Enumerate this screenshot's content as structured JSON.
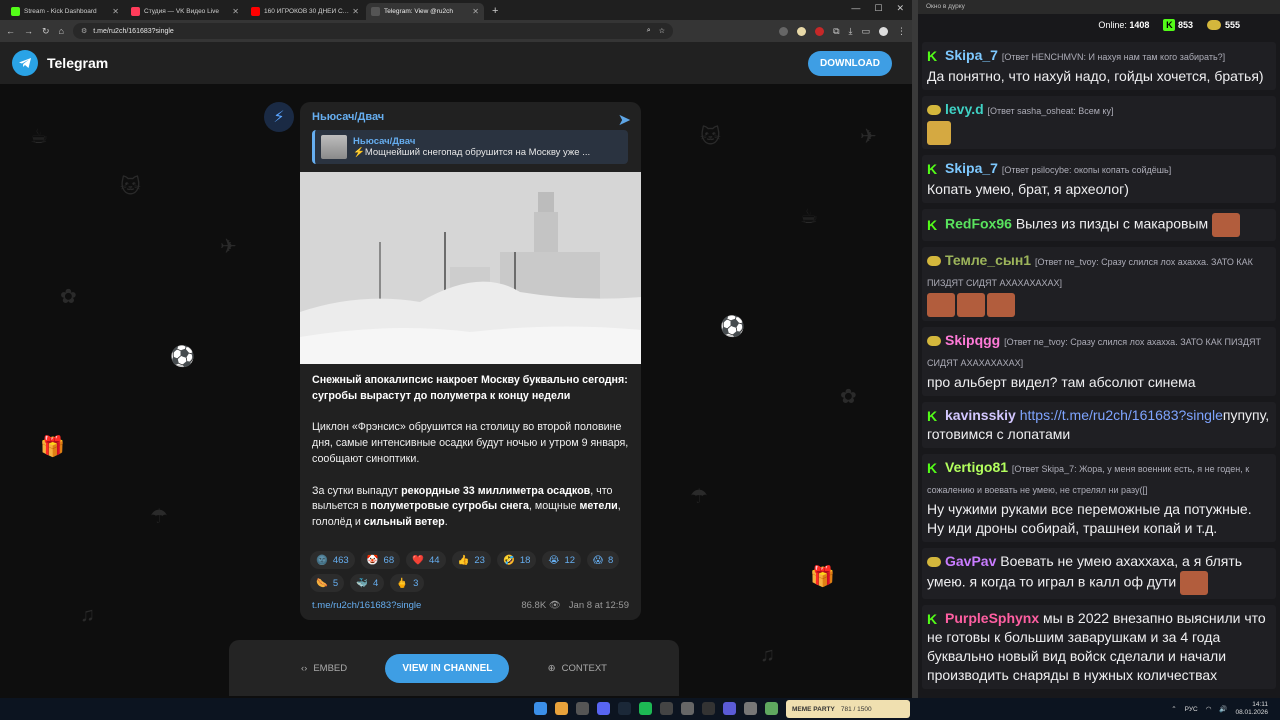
{
  "tabs": [
    {
      "title": "Stream - Kick Dashboard",
      "color": "#53fc18"
    },
    {
      "title": "Студия — VK Видео Live",
      "color": "#ff3c5a"
    },
    {
      "title": "160 ИГРОКОВ 30 ДНЕЙ СТРОЯ",
      "color": "#ff0000"
    },
    {
      "title": "Telegram: View @ru2ch",
      "color": "#555555"
    }
  ],
  "address": {
    "url": "t.me/ru2ch/161683?single"
  },
  "telegram": {
    "brand": "Telegram",
    "download": "DOWNLOAD"
  },
  "post": {
    "channel": "Ньюсач/Двач",
    "reply_name": "Ньюсач/Двач",
    "reply_text": "⚡️Мощнейший снегопад обрушится на Москву уже ...",
    "p1": "Снежный апокалипсис накроет Москву буквально сегодня: сугробы вырастут до полуметра к концу недели",
    "p2": "Циклон «Фрэнсис» обрушится на столицу во второй половине дня, самые интенсивные осадки будут ночью и утром 9 января, сообщают синоптики.",
    "p3a": "За сутки выпадут ",
    "p3b": "рекордные 33 миллиметра осадков",
    "p3c": ", что выльется в ",
    "p3d": "полуметровые сугробы снега",
    "p3e": ", мощные ",
    "p3f": "метели",
    "p3g": ", гололёд и ",
    "p3h": "сильный ветер",
    "p3i": ".",
    "link": "t.me/ru2ch/161683?single",
    "views": "86.8K",
    "date": "Jan 8 at 12:59",
    "reactions": [
      {
        "emoji": "🌚",
        "count": "463"
      },
      {
        "emoji": "🤡",
        "count": "68"
      },
      {
        "emoji": "❤️",
        "count": "44"
      },
      {
        "emoji": "👍",
        "count": "23"
      },
      {
        "emoji": "🤣",
        "count": "18"
      },
      {
        "emoji": "😭",
        "count": "12"
      },
      {
        "emoji": "😱",
        "count": "8"
      },
      {
        "emoji": "🌭",
        "count": "5"
      },
      {
        "emoji": "🐳",
        "count": "4"
      },
      {
        "emoji": "🖕",
        "count": "3"
      }
    ]
  },
  "actions": {
    "embed": "EMBED",
    "view": "VIEW IN CHANNEL",
    "context": "CONTEXT"
  },
  "chat": {
    "window_title": "Окно в дурку",
    "online_label": "Online:",
    "online": "1408",
    "count1": "853",
    "count2": "555",
    "messages": [
      {
        "user": "Skipa_7",
        "color": "#7ec9ff",
        "badge": "kick",
        "reply": "[Ответ HENCHMVN: И нахуя нам там кого забирать?]",
        "text": "Да понятно, что нахуй надо, гойды хочется, братья)"
      },
      {
        "user": "levy.d",
        "color": "#3fd1c4",
        "badge": "emo",
        "reply": "[Ответ sasha_osheat: Всем ку]",
        "text": ""
      },
      {
        "user": "Skipa_7",
        "color": "#7ec9ff",
        "badge": "kick",
        "reply": "[Ответ psilocybe: окопы копать сойдёшь]",
        "text": "Копать умею, брат, я археолог)"
      },
      {
        "user": "RedFox96",
        "color": "#59e35e",
        "badge": "kick",
        "reply": "",
        "text": "Вылез из пизды с макаровым"
      },
      {
        "user": "Темле_сын1",
        "color": "#9db55b",
        "badge": "emo",
        "reply": "[Ответ ne_tvoy: Сразу слился лох ахахха. ЗАТО КАК ПИЗДЯТ СИДЯТ АХАХАХАХАХ]",
        "text": ""
      },
      {
        "user": "Skipqgg",
        "color": "#ff7ad8",
        "badge": "emo",
        "reply": "[Ответ ne_tvoy: Сразу слился лох ахахха. ЗАТО КАК ПИЗДЯТ СИДЯТ АХАХАХАХАХ]",
        "text": "про альберт видел? там абсолют синема"
      },
      {
        "user": "kavinsskiy",
        "color": "#d3c7ff",
        "badge": "kick",
        "reply": "",
        "link": "https://t.me/ru2ch/161683?single",
        "text": "пупупу, готовимся с лопатами"
      },
      {
        "user": "Vertigo81",
        "color": "#b3ff5e",
        "badge": "kick",
        "reply": "[Ответ Skipa_7: Жора, у меня военник есть, я не годен, к сожалению и воевать не умею, не стрелял ни разу([]",
        "text": "Ну чужими руками все переможные да потужные. Ну иди дроны собирай, трашнеи копай и т.д."
      },
      {
        "user": "GavPav",
        "color": "#c97cff",
        "badge": "emo",
        "reply": "",
        "text": "Воевать не умею ахаххаха, а я блять умею. я когда то играл в калл оф дути"
      },
      {
        "user": "PurpleSphynx",
        "color": "#ff5fa2",
        "badge": "kick",
        "reply": "",
        "text": "мы в 2022 внезапно выяснили что не готовы к большим заварушкам и за 4 года буквально новый вид войск сделали и начали производить снаряды в нужных количествах"
      }
    ]
  },
  "taskbar": {
    "lang": "РУС",
    "time": "14:11",
    "date": "08.01.2026",
    "widget": "MEME PARTY",
    "widget_val": "781 / 1500"
  }
}
